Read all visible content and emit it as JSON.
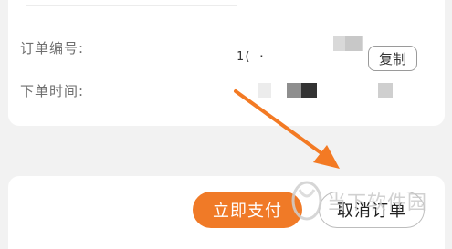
{
  "order": {
    "number_label": "订单编号:",
    "number_value_fragment": "1( ·",
    "time_label": "下单时间:"
  },
  "buttons": {
    "copy": "复制",
    "pay_now": "立即支付",
    "cancel_order": "取消订单"
  },
  "watermark": {
    "logo_text": "当下软件园"
  },
  "colors": {
    "accent": "#f07a27",
    "annotation_arrow": "#f37a24"
  }
}
